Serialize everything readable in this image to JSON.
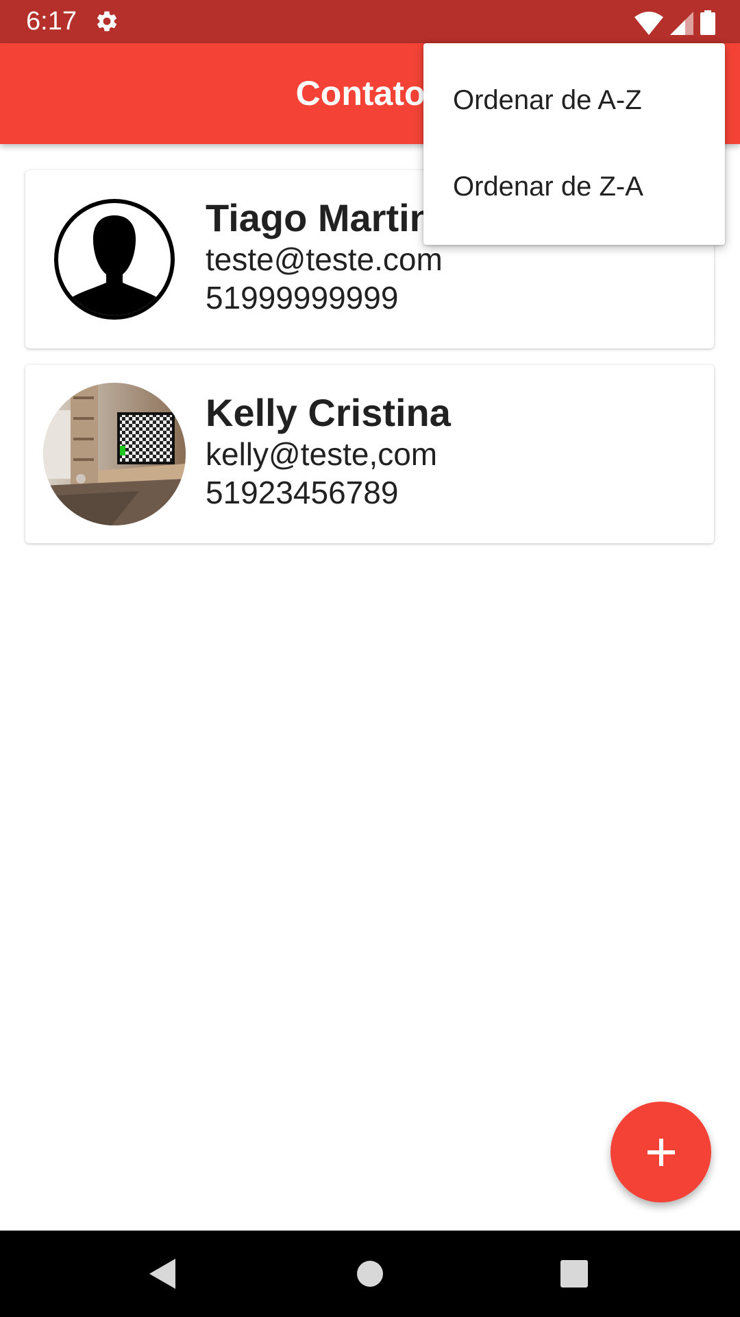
{
  "status_bar": {
    "time": "6:17",
    "icons": [
      "gear-icon",
      "wifi-icon",
      "signal-icon",
      "battery-icon"
    ]
  },
  "app_bar": {
    "title": "Contatos",
    "color": "#f44336"
  },
  "contacts": [
    {
      "name": "Tiago Martins",
      "email": "teste@teste.com",
      "phone": "51999999999",
      "avatar": "default-person-avatar"
    },
    {
      "name": "Kelly Cristina",
      "email": "kelly@teste,com",
      "phone": "51923456789",
      "avatar": "photo-avatar"
    }
  ],
  "menu": {
    "items": [
      {
        "label": "Ordenar de A-Z"
      },
      {
        "label": "Ordenar de Z-A"
      }
    ]
  },
  "fab": {
    "icon": "plus-icon",
    "color": "#f44336"
  },
  "nav_bar": {
    "icons": [
      "back-icon",
      "home-icon",
      "recent-apps-icon"
    ]
  },
  "colors": {
    "status_bar": "#b5302a",
    "accent": "#f44336"
  }
}
